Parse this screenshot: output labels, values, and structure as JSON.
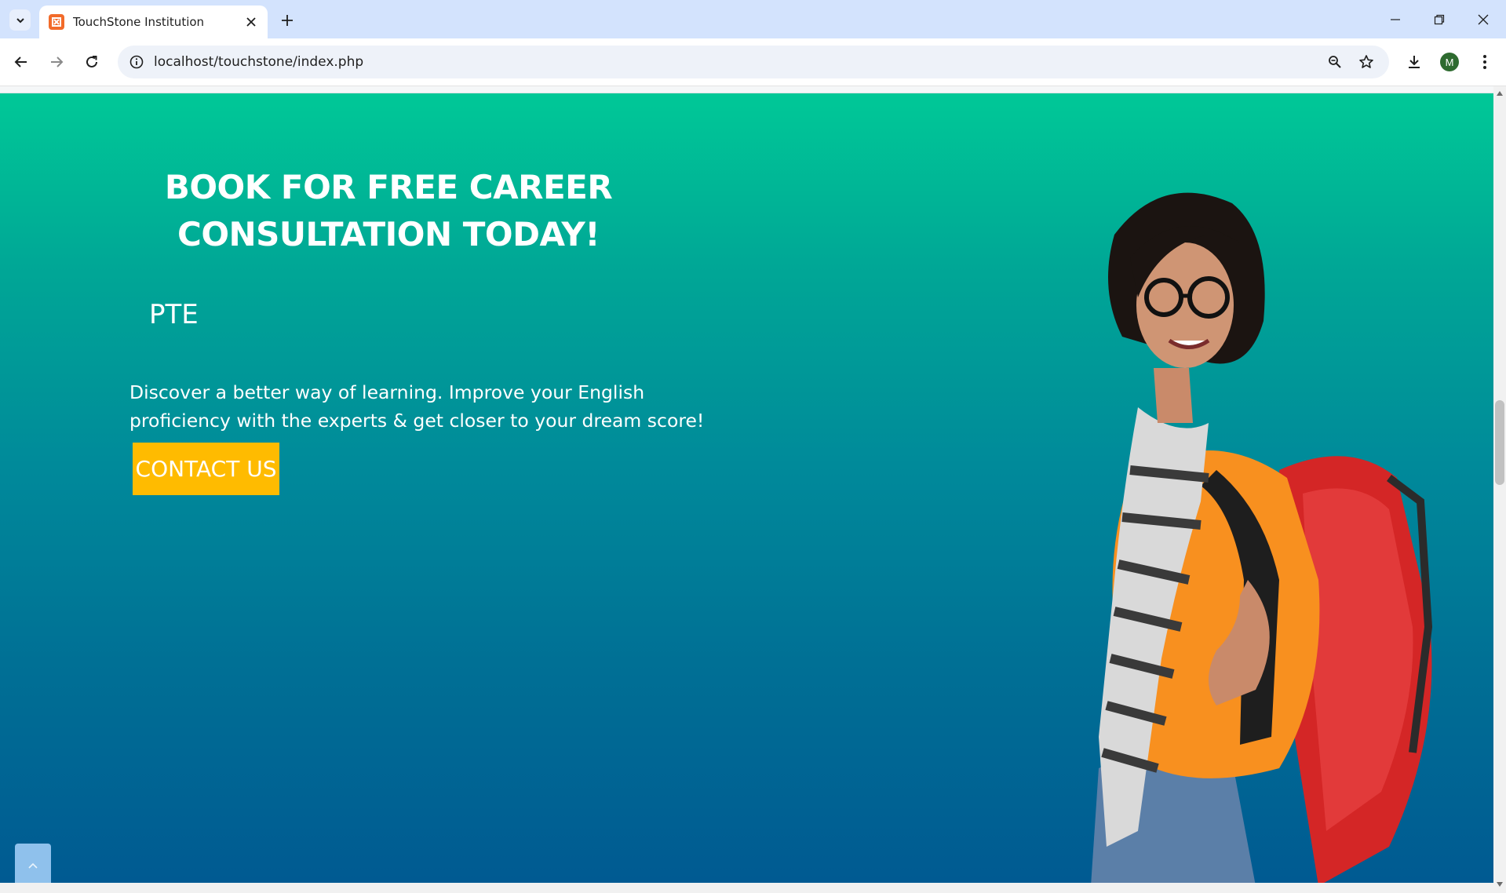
{
  "browser": {
    "tab_title": "TouchStone Institution",
    "favicon_letter": "X",
    "url": "localhost/touchstone/index.php",
    "profile_initial": "M"
  },
  "hero": {
    "title": "BOOK FOR FREE CAREER CONSULTATION TODAY!",
    "course": "PTE",
    "description": "Discover a better way of learning. Improve your English proficiency with the experts & get closer to your dream score!",
    "button_label": "CONTACT US"
  },
  "colors": {
    "gradient_top": "#00c897",
    "gradient_bottom": "#005a92",
    "button": "#ffbb00",
    "back_to_top": "#8fc1ec"
  },
  "icons": {
    "tab_list": "chevron-down-icon",
    "back": "arrow-left-icon",
    "forward": "arrow-right-icon",
    "reload": "reload-icon",
    "site_info": "info-icon",
    "zoom": "zoom-icon",
    "bookmark": "star-icon",
    "download": "download-icon",
    "menu": "kebab-menu-icon",
    "back_to_top": "chevron-up-icon"
  }
}
